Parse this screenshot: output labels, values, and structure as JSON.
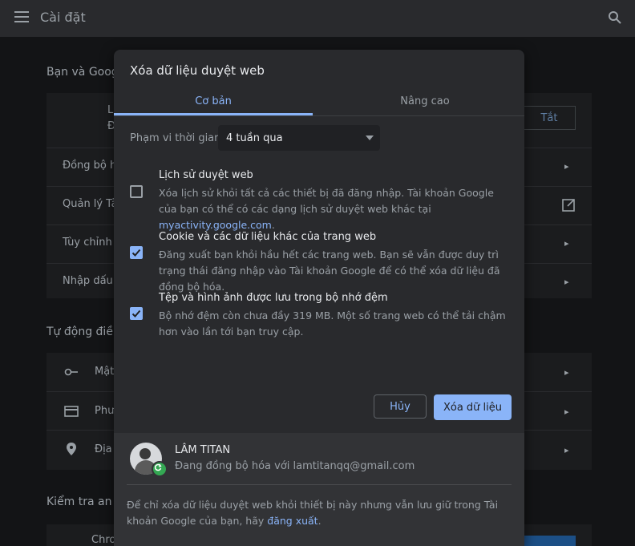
{
  "app": {
    "title": "Cài đặt"
  },
  "background": {
    "sections": [
      {
        "title": "Bạn và Googl"
      },
      {
        "title": "Tự động điền"
      },
      {
        "title": "Kiểm tra an to"
      }
    ],
    "profile": {
      "name_initial": "L",
      "sub_initial": "Đ",
      "turn_off_label": "Tắt"
    },
    "rows_you_google": [
      "Đồng bộ hó",
      "Quản lý Tài",
      "Tùy chỉnh h",
      "Nhập dấu t"
    ],
    "rows_autofill": [
      "Mật",
      "Phư",
      "Địa"
    ],
    "safety_row": "Chrom"
  },
  "dialog": {
    "title": "Xóa dữ liệu duyệt web",
    "tabs": [
      {
        "label": "Cơ bản",
        "active": true
      },
      {
        "label": "Nâng cao",
        "active": false
      }
    ],
    "time_range": {
      "label": "Phạm vi thời gian",
      "value": "4 tuần qua"
    },
    "options": [
      {
        "title": "Lịch sử duyệt web",
        "checked": false,
        "desc": "Xóa lịch sử khỏi tất cả các thiết bị đã đăng nhập. Tài khoản Google của bạn có thể có các dạng lịch sử duyệt web khác tại ",
        "link": "myactivity.google.com",
        "desc_end": "."
      },
      {
        "title": "Cookie và các dữ liệu khác của trang web",
        "checked": true,
        "desc": "Đăng xuất bạn khỏi hầu hết các trang web. Bạn sẽ vẫn được duy trì trạng thái đăng nhập vào Tài khoản Google để có thể xóa dữ liệu đã đồng bộ hóa."
      },
      {
        "title": "Tệp và hình ảnh được lưu trong bộ nhớ đệm",
        "checked": true,
        "desc": "Bộ nhớ đệm còn chưa đầy 319 MB. Một số trang web có thể tải chậm hơn vào lần tới bạn truy cập."
      }
    ],
    "cancel_label": "Hủy",
    "clear_label": "Xóa dữ liệu",
    "account": {
      "name": "LÂM TITAN",
      "sync_text": "Đang đồng bộ hóa với lamtitanqq@gmail.com"
    },
    "footer_note": "Để chỉ xóa dữ liệu duyệt web khỏi thiết bị này nhưng vẫn lưu giữ trong Tài khoản Google của bạn, hãy ",
    "footer_link": "đăng xuất",
    "footer_end": "."
  }
}
